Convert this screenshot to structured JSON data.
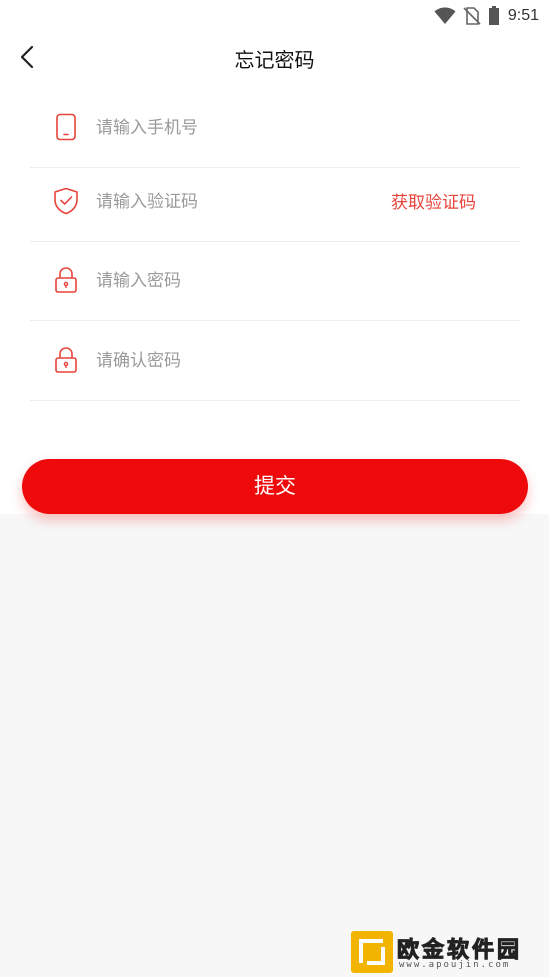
{
  "status_bar": {
    "time": "9:51",
    "icons": [
      "wifi-icon",
      "no-sim-icon",
      "battery-icon"
    ]
  },
  "header": {
    "title": "忘记密码",
    "back_icon": "chevron-left-icon"
  },
  "form": {
    "phone": {
      "placeholder": "请输入手机号",
      "value": "",
      "icon": "phone-icon"
    },
    "code": {
      "placeholder": "请输入验证码",
      "value": "",
      "icon": "shield-check-icon",
      "get_code_label": "获取验证码"
    },
    "password": {
      "placeholder": "请输入密码",
      "value": "",
      "icon": "lock-icon"
    },
    "confirm_password": {
      "placeholder": "请确认密码",
      "value": "",
      "icon": "lock-icon"
    }
  },
  "submit": {
    "label": "提交"
  },
  "watermark": {
    "title": "欧金软件园",
    "url": "www.apoujin.com"
  },
  "colors": {
    "accent": "#ee0a0a",
    "link": "#e8433b",
    "icon": "#e8433b",
    "background": "#f7f7f7"
  }
}
